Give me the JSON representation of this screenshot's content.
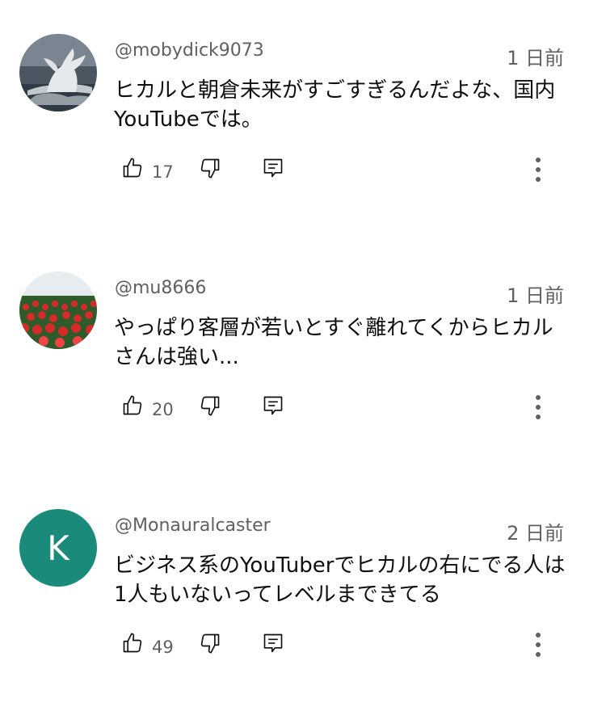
{
  "comments": [
    {
      "username": "@mobydick9073",
      "date": "1 日前",
      "text": "ヒカルと朝倉未来がすごすぎるんだよな、国内YouTubeでは。",
      "likes": "17",
      "avatar_type": "whale-photo"
    },
    {
      "username": "@mu8666",
      "date": "1 日前",
      "text": "やっぱり客層が若いとすぐ離れてくからヒカルさんは強い...",
      "likes": "20",
      "avatar_type": "tulip-photo"
    },
    {
      "username": "@Monauralcaster",
      "date": "2 日前",
      "text": "ビジネス系のYouTuberでヒカルの右にでる人は1人もいないってレベルまできてる",
      "likes": "49",
      "avatar_type": "letter",
      "avatar_letter": "K",
      "avatar_color": "#1a8a7a"
    }
  ],
  "icons": {
    "like": "thumbs-up-icon",
    "dislike": "thumbs-down-icon",
    "reply": "reply-icon",
    "more": "more-vertical-icon"
  }
}
